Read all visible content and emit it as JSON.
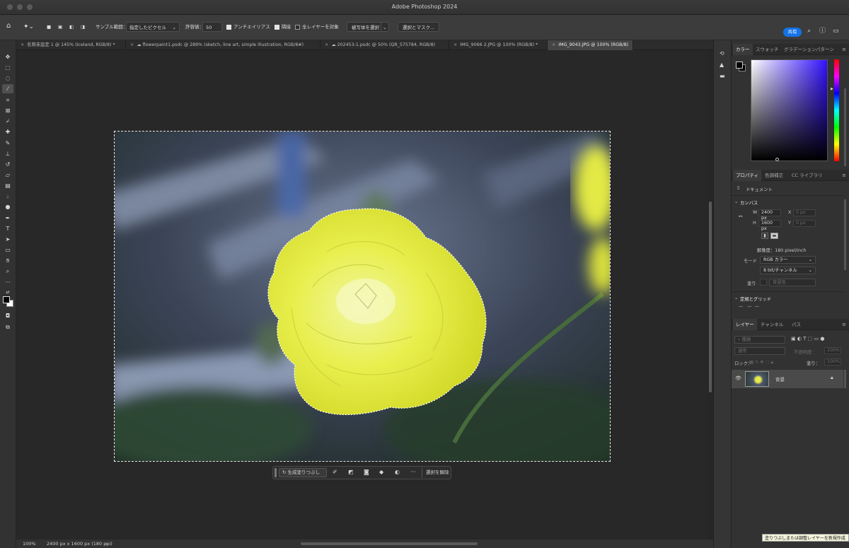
{
  "app": {
    "title": "Adobe Photoshop 2024"
  },
  "options": {
    "sample_label": "サンプル範囲：",
    "sample_value": "指定したピクセル",
    "tolerance_label": "許容値：",
    "tolerance_value": "50",
    "antialias": "アンチエイリアス",
    "contiguous": "隣接",
    "all_layers": "全レイヤーを対象",
    "select_subject": "被写体を選択",
    "select_mask": "選択とマスク...",
    "share": "共有"
  },
  "tabs": [
    {
      "label": "名称未設定 1 @ 145% (Iceland, RGB/8) *"
    },
    {
      "label": "flowerpaint1.psdc @ 289% (sketch, line art, simple illustration, RGB/8#)"
    },
    {
      "label": "202453-1.psdc @ 50% (QR_575784, RGB/8)"
    },
    {
      "label": "IMG_9066 2.JPG @ 100% (RGB/8) *"
    },
    {
      "label": "IMG_9043.JPG @ 100% (RGB/8)"
    }
  ],
  "contextbar": {
    "generative_fill": "生成塗りつぶし",
    "deselect": "選択を解除"
  },
  "status": {
    "zoom": "100%",
    "doc_info": "2400 px x 1600 px (180 ppi)"
  },
  "tooltip": "塗りつぶしまたは調整レイヤーを新規作成",
  "color_panel": {
    "tabs": [
      "カラー",
      "スウォッチ",
      "グラデーション",
      "パターン"
    ],
    "hue_color": "#3311ff",
    "foreground": "#000000",
    "background": "#ffffff"
  },
  "properties": {
    "tabs": [
      "プロパティ",
      "色調補正",
      "CC ライブラリ"
    ],
    "doc_label": "ドキュメント",
    "canvas_section": "カンバス",
    "w_label": "W",
    "w_value": "2400 px",
    "h_label": "H",
    "h_value": "1600 px",
    "x_label": "X",
    "x_value": "0 px",
    "y_label": "Y",
    "y_value": "0 px",
    "resolution": "解像度：180 pixel/inch",
    "mode_label": "モード",
    "mode_value": "RGB カラー",
    "depth_value": "8 bit/チャンネル",
    "fill_label": "塗り",
    "fill_value": "背景色",
    "rulers_section": "定規とグリッド"
  },
  "layers_panel": {
    "tabs": [
      "レイヤー",
      "チャンネル",
      "パス"
    ],
    "kind_label": "種類",
    "blend_mode": "通常",
    "opacity_label": "不透明度：",
    "opacity_value": "100%",
    "lock_label": "ロック：",
    "fill_label": "塗り：",
    "fill_value": "100%",
    "layer_name": "背景"
  }
}
